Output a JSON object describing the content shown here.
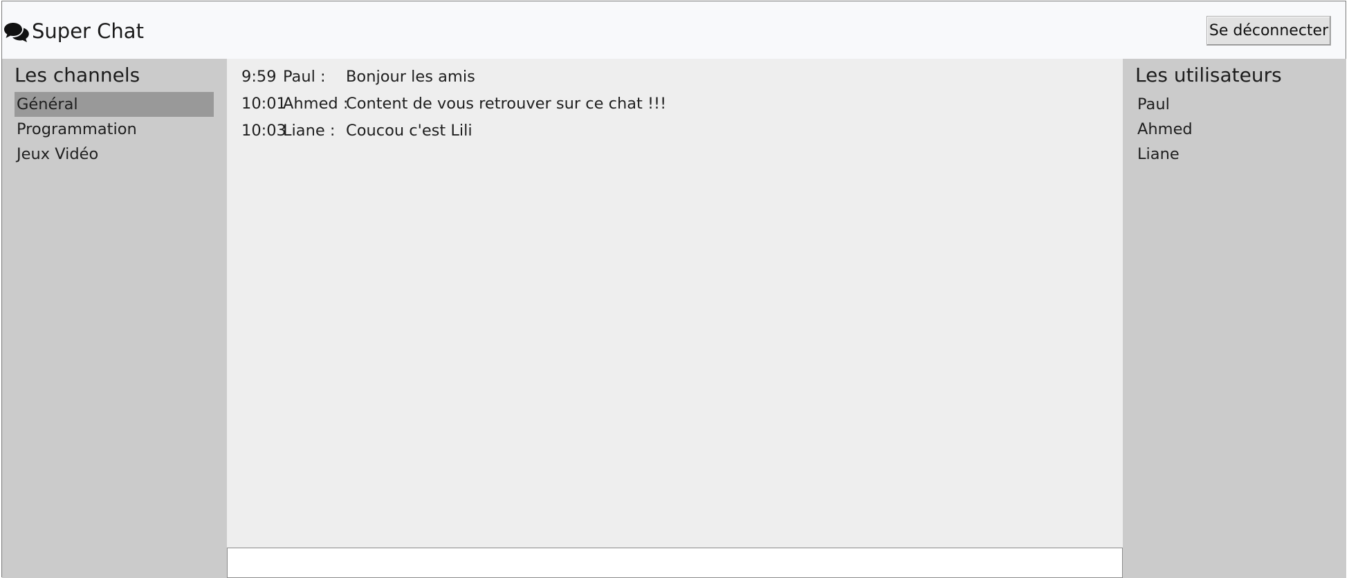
{
  "app": {
    "title": "Super Chat",
    "logo_icon": "comments-icon"
  },
  "header": {
    "logout_label": "Se déconnecter"
  },
  "channels": {
    "title": "Les channels",
    "items": [
      {
        "label": "Général",
        "active": true
      },
      {
        "label": "Programmation",
        "active": false
      },
      {
        "label": "Jeux Vidéo",
        "active": false
      }
    ]
  },
  "messages": [
    {
      "time": "9:59",
      "author": "Paul :",
      "text": "Bonjour les amis"
    },
    {
      "time": "10:01",
      "author": "Ahmed :",
      "text": "Content de vous retrouver sur ce chat !!!"
    },
    {
      "time": "10:03",
      "author": "Liane :",
      "text": "Coucou c'est Lili"
    }
  ],
  "users": {
    "title": "Les utilisateurs",
    "items": [
      "Paul",
      "Ahmed",
      "Liane"
    ]
  },
  "composer": {
    "value": "",
    "placeholder": ""
  },
  "colors": {
    "header_bg": "#f8f9fb",
    "sidebar_bg": "#cbcbcb",
    "chat_bg": "#eeeeee",
    "active_channel_bg": "#999999"
  }
}
